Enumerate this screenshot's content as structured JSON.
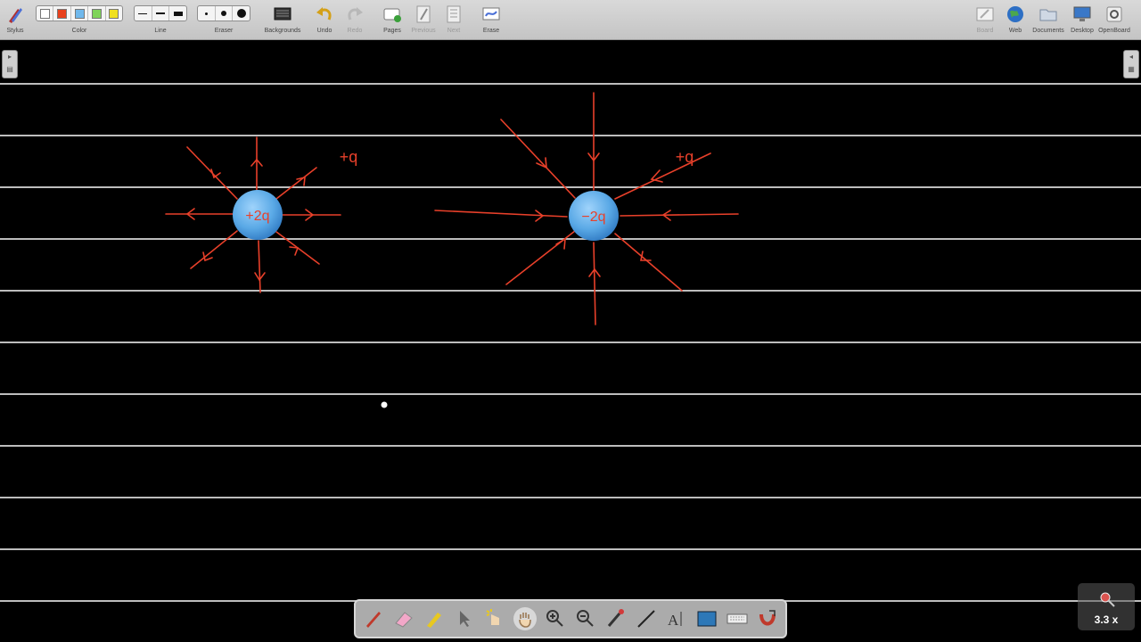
{
  "toolbar": {
    "stylus": "Stylus",
    "color": "Color",
    "line": "Line",
    "eraser": "Eraser",
    "backgrounds": "Backgrounds",
    "undo": "Undo",
    "redo": "Redo",
    "pages": "Pages",
    "previous": "Previous",
    "next": "Next",
    "erase": "Erase",
    "board": "Board",
    "web": "Web",
    "documents": "Documents",
    "desktop": "Desktop",
    "openboard": "OpenBoard"
  },
  "colors": {
    "swatches": [
      "#ffffff",
      "#e8401c",
      "#6fb8ec",
      "#7fd35a",
      "#f0e020"
    ],
    "ink": "#e8402a",
    "charge_fill": "#5aa9e6",
    "ruled_line": "#bdbdbd",
    "board_bg": "#000000"
  },
  "board": {
    "charge_left": "+2q",
    "charge_right": "−2q",
    "label_left": "+q",
    "label_right": "+q"
  },
  "dock": {
    "tools": [
      "pen-icon",
      "eraser-icon",
      "highlighter-icon",
      "selector-icon",
      "interact-icon",
      "hand-icon",
      "zoom-in-icon",
      "zoom-out-icon",
      "pointer-icon",
      "line-icon",
      "text-icon",
      "capture-icon",
      "keyboard-icon",
      "magnet-icon"
    ]
  },
  "zoom": {
    "label": "3.3 x"
  }
}
